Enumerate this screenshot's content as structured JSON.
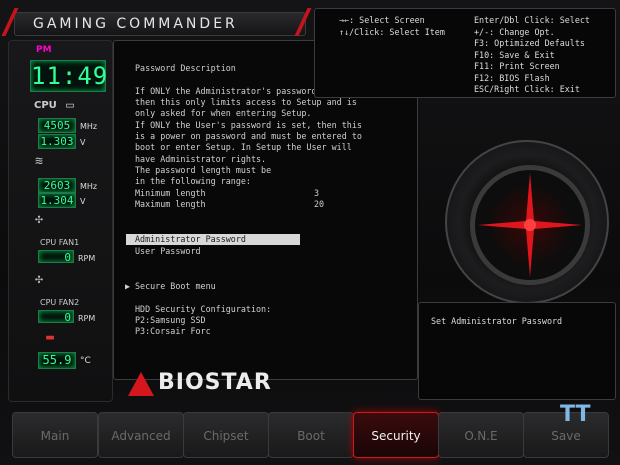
{
  "app": {
    "title": "GAMING COMMANDER"
  },
  "left": {
    "time_label": "PM",
    "time": "11:49",
    "cpu_label": "CPU",
    "cpu_freq": "4505",
    "cpu_freq_unit": "MHz",
    "cpu_volt": "1.303",
    "cpu_volt_unit": "V",
    "mem_freq": "2603",
    "mem_freq_unit": "MHz",
    "mem_volt": "1.304",
    "mem_volt_unit": "V",
    "fan1_label": "CPU FAN1",
    "fan1_value": "0",
    "fan1_unit": "RPM",
    "fan2_label": "CPU FAN2",
    "fan2_value": "0",
    "fan2_unit": "RPM",
    "temp_value": "55.9",
    "temp_unit": "°C"
  },
  "main": {
    "heading": "Password Description",
    "lines": [
      "If ONLY the Administrator's password is set,",
      "then this only limits access to Setup and is",
      "only asked for when entering Setup.",
      "If ONLY the User's password is set, then this",
      "is a power on password and must be entered to",
      "boot or enter Setup. In Setup the User will",
      "have Administrator rights.",
      "The password length must be",
      "in the following range:"
    ],
    "min_label": "Minimum length",
    "min_value": "3",
    "max_label": "Maximum length",
    "max_value": "20",
    "admin_password": "Administrator Password",
    "user_password": "User Password",
    "secure_boot": "Secure Boot menu",
    "hdd_heading": "HDD Security Configuration:",
    "hdd1": "P2:Samsung SSD",
    "hdd2": "P3:Corsair Forc"
  },
  "help": {
    "left": [
      "→←: Select Screen",
      "↑↓/Click: Select Item"
    ],
    "right": [
      "Enter/Dbl Click: Select",
      "+/-: Change Opt.",
      "F3: Optimized Defaults",
      "F10: Save & Exit",
      "F11: Print Screen",
      "F12: BIOS Flash",
      "ESC/Right Click: Exit"
    ]
  },
  "item_help": "Set Administrator Password",
  "brand": "BIOSTAR",
  "tabs": [
    "Main",
    "Advanced",
    "Chipset",
    "Boot",
    "Security",
    "O.N.E",
    "Save"
  ],
  "active_tab": "Security",
  "colors": {
    "accent": "#c81b21",
    "lcd": "#33ff99"
  }
}
